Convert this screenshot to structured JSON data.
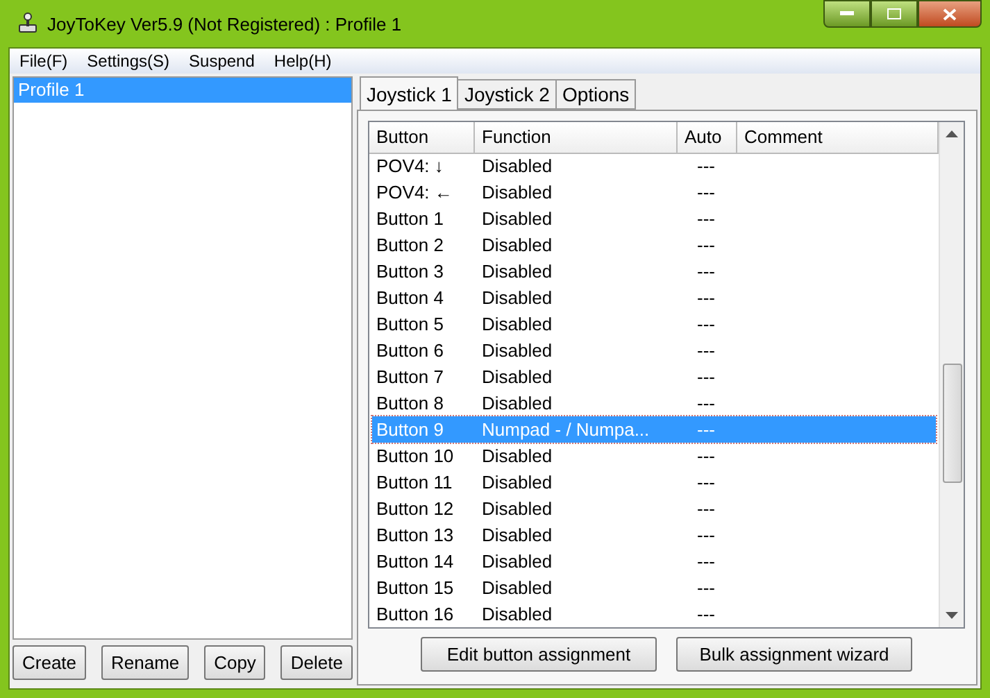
{
  "window": {
    "title": "JoyToKey Ver5.9 (Not Registered) : Profile 1"
  },
  "menu": [
    "File(F)",
    "Settings(S)",
    "Suspend",
    "Help(H)"
  ],
  "profiles": [
    {
      "label": "Profile 1",
      "selected": true
    }
  ],
  "profile_buttons": [
    "Create",
    "Rename",
    "Copy",
    "Delete"
  ],
  "tabs": [
    {
      "label": "Joystick 1",
      "selected": true
    },
    {
      "label": "Joystick 2",
      "selected": false
    },
    {
      "label": "Options",
      "selected": false
    }
  ],
  "table": {
    "columns": [
      "Button",
      "Function",
      "Auto",
      "Comment"
    ],
    "rows": [
      {
        "button": "POV4: ↓",
        "function": "Disabled",
        "auto": "---",
        "selected": false
      },
      {
        "button": "POV4: ←",
        "function": "Disabled",
        "auto": "---",
        "selected": false
      },
      {
        "button": "Button 1",
        "function": "Disabled",
        "auto": "---",
        "selected": false
      },
      {
        "button": "Button 2",
        "function": "Disabled",
        "auto": "---",
        "selected": false
      },
      {
        "button": "Button 3",
        "function": "Disabled",
        "auto": "---",
        "selected": false
      },
      {
        "button": "Button 4",
        "function": "Disabled",
        "auto": "---",
        "selected": false
      },
      {
        "button": "Button 5",
        "function": "Disabled",
        "auto": "---",
        "selected": false
      },
      {
        "button": "Button 6",
        "function": "Disabled",
        "auto": "---",
        "selected": false
      },
      {
        "button": "Button 7",
        "function": "Disabled",
        "auto": "---",
        "selected": false
      },
      {
        "button": "Button 8",
        "function": "Disabled",
        "auto": "---",
        "selected": false
      },
      {
        "button": "Button 9",
        "function": "Numpad - / Numpa...",
        "auto": "---",
        "selected": true
      },
      {
        "button": "Button 10",
        "function": "Disabled",
        "auto": "---",
        "selected": false
      },
      {
        "button": "Button 11",
        "function": "Disabled",
        "auto": "---",
        "selected": false
      },
      {
        "button": "Button 12",
        "function": "Disabled",
        "auto": "---",
        "selected": false
      },
      {
        "button": "Button 13",
        "function": "Disabled",
        "auto": "---",
        "selected": false
      },
      {
        "button": "Button 14",
        "function": "Disabled",
        "auto": "---",
        "selected": false
      },
      {
        "button": "Button 15",
        "function": "Disabled",
        "auto": "---",
        "selected": false
      },
      {
        "button": "Button 16",
        "function": "Disabled",
        "auto": "---",
        "selected": false
      }
    ]
  },
  "actions": [
    "Edit button assignment",
    "Bulk assignment wizard"
  ]
}
